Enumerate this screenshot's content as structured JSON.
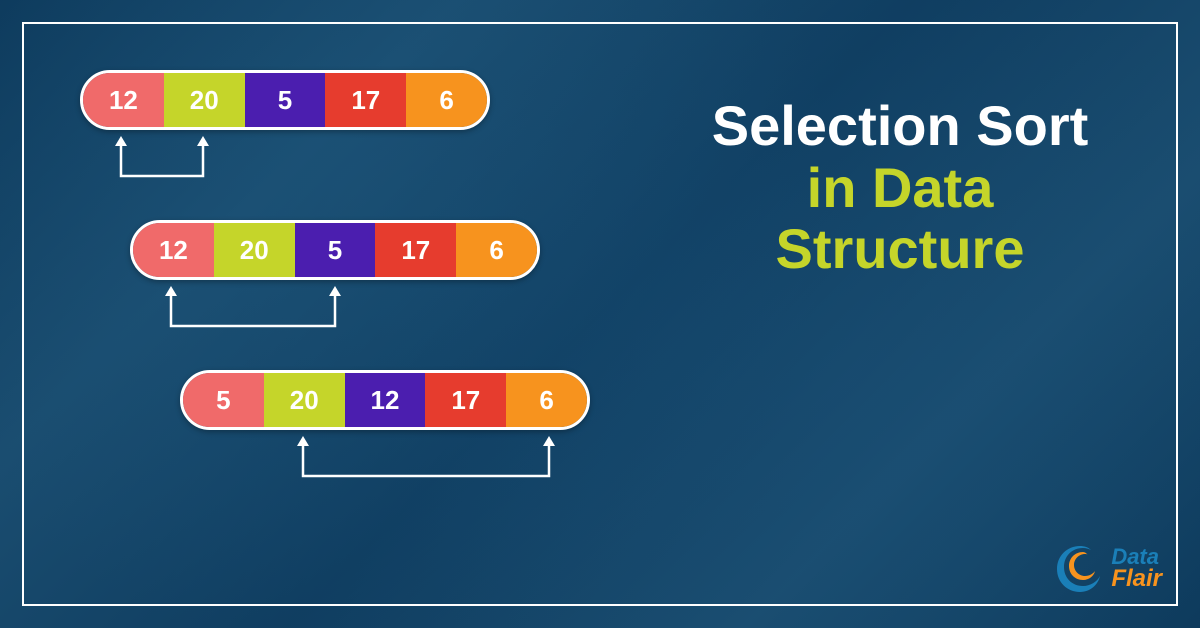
{
  "title": {
    "line1": "Selection Sort",
    "line2": "in Data",
    "line3": "Structure"
  },
  "colors": {
    "pink": "#f06a6a",
    "lime": "#c5d52a",
    "purple": "#4b1eaf",
    "red": "#e63c2e",
    "orange": "#f7931e"
  },
  "rows": [
    {
      "offset": 0,
      "values": [
        "12",
        "20",
        "5",
        "17",
        "6"
      ],
      "arrow": {
        "from": 0,
        "to": 1
      }
    },
    {
      "offset": 50,
      "values": [
        "12",
        "20",
        "5",
        "17",
        "6"
      ],
      "arrow": {
        "from": 0,
        "to": 2
      }
    },
    {
      "offset": 100,
      "values": [
        "5",
        "20",
        "12",
        "17",
        "6"
      ],
      "arrow": {
        "from": 1,
        "to": 4
      }
    }
  ],
  "cellColors": [
    "pink",
    "lime",
    "purple",
    "red",
    "orange"
  ],
  "logo": {
    "brand1": "Data",
    "brand2": "Flair"
  }
}
